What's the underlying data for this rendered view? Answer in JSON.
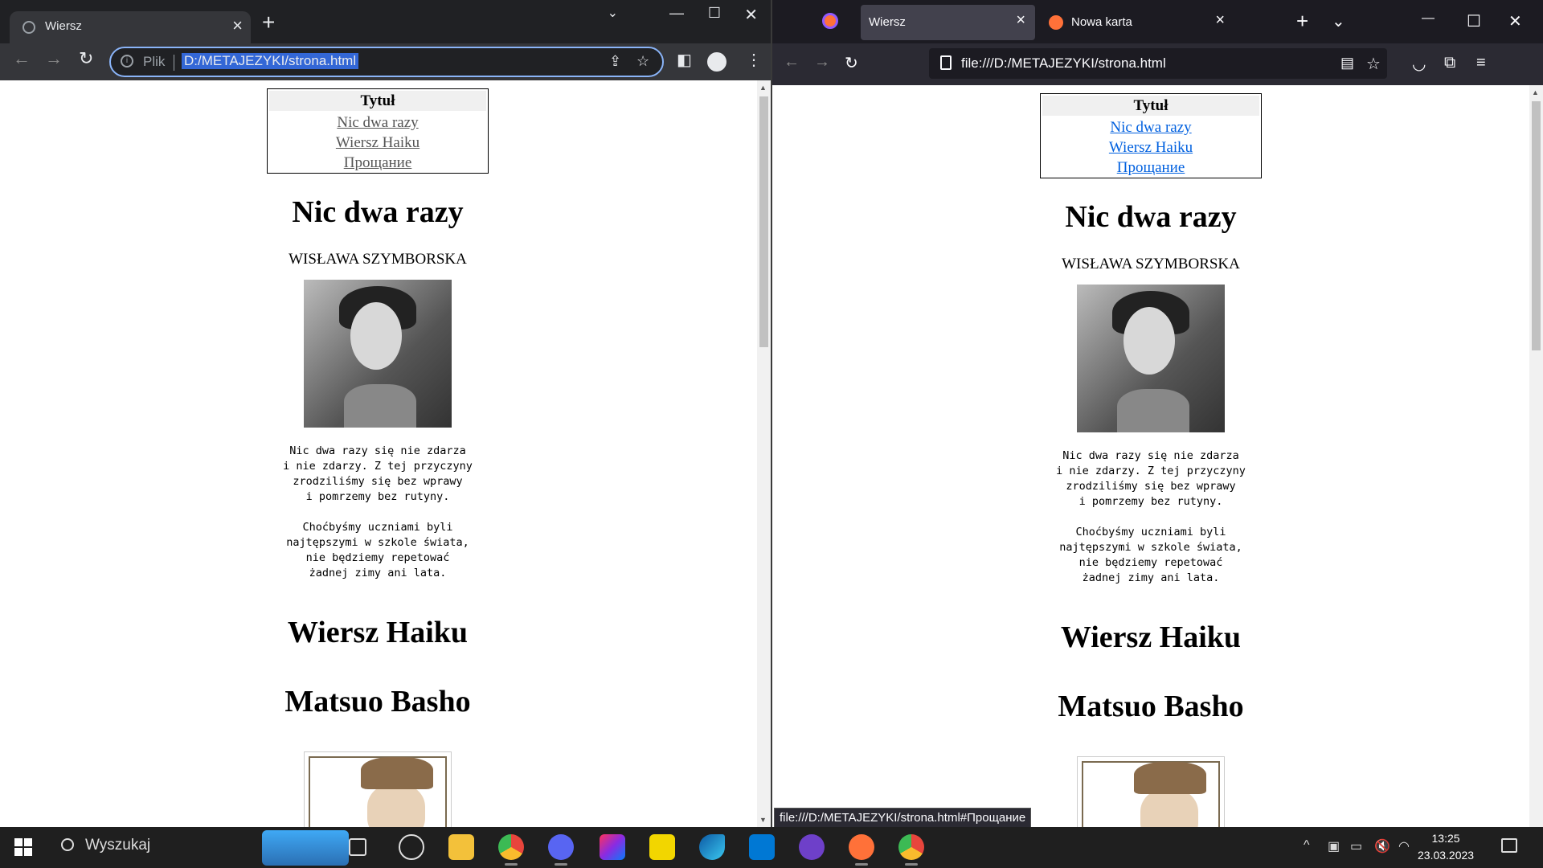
{
  "chrome": {
    "tab_title": "Wiersz",
    "new_tab": "+",
    "address_scheme": "Plik",
    "address_url": "D:/METAJEZYKI/strona.html"
  },
  "firefox": {
    "tabs": [
      {
        "label": "Wiersz",
        "active": true
      },
      {
        "label": "Nowa karta",
        "active": false
      }
    ],
    "address_url": "file:///D:/METAJEZYKI/strona.html",
    "status_link": "file:///D:/METAJEZYKI/strona.html#Прощание"
  },
  "page": {
    "toc": {
      "header": "Tytuł",
      "links": [
        "Nic dwa razy",
        "Wiersz Haiku",
        "Прощание"
      ]
    },
    "poem1": {
      "title": "Nic dwa razy",
      "author": "WISŁAWA SZYMBORSKA",
      "stanza1": "Nic dwa razy się nie zdarza\ni nie zdarzy. Z tej przyczyny\nzrodziliśmy się bez wprawy\ni pomrzemy bez rutyny.",
      "stanza2": "Choćbyśmy uczniami byli\nnajtępszymi w szkole świata,\nnie będziemy repetować\nżadnej zimy ani lata."
    },
    "poem2": {
      "title": "Wiersz Haiku",
      "author": "Matsuo Basho"
    }
  },
  "taskbar": {
    "search": "Wyszukaj",
    "time": "13:25",
    "date": "23.03.2023",
    "apps": [
      "task-view-icon",
      "dell-icon",
      "file-explorer-icon",
      "chrome-icon",
      "discord-icon",
      "intellij-icon",
      "todo-icon",
      "edge-icon",
      "vscode-icon",
      "github-desktop-icon",
      "firefox-icon",
      "chrome-icon"
    ],
    "accent_colors": {
      "chrome": "#e8453c",
      "discord": "#5865f2",
      "vscode": "#0078d4",
      "firefox": "#ff7139",
      "todo": "#f2d600",
      "github": "#6e40c9"
    }
  }
}
